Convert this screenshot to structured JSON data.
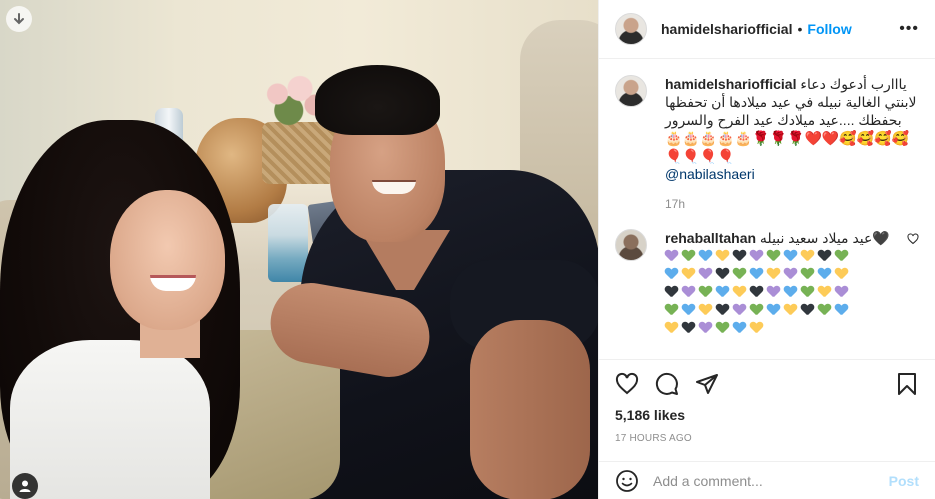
{
  "post": {
    "username": "hamidelshariofficial",
    "follow_label": "Follow",
    "dot": "•",
    "more_label": "•••"
  },
  "caption": {
    "username": "hamidelshariofficial",
    "text": "يااارب أدعوك دعاء لابنتي الغالية نبيله في عيد ميلادها أن تحفظها بحفظك ....عيد ميلادك عيد الفرح والسرور🥰🥰🥰🥰❤️❤️🌹🌹🌹🎂🎂🎂🎂🎂🎈🎈🎈🎈",
    "mention": "@nabilashaeri",
    "time": "17h"
  },
  "reply": {
    "username": "rehaballtahan",
    "text": "🖤عيد ميلاد سعيد نبيله",
    "heart_rows": [
      [
        "purple",
        "green",
        "blue",
        "yellow",
        "black",
        "purple",
        "green",
        "blue",
        "yellow",
        "black",
        "green"
      ],
      [
        "blue",
        "yellow",
        "purple",
        "black",
        "green",
        "blue",
        "yellow",
        "purple",
        "green",
        "blue",
        "yellow"
      ],
      [
        "black",
        "purple",
        "green",
        "blue",
        "yellow",
        "black",
        "purple",
        "blue",
        "green",
        "yellow",
        "purple"
      ],
      [
        "green",
        "blue",
        "yellow",
        "black",
        "purple",
        "green",
        "blue",
        "yellow",
        "black",
        "green",
        "blue"
      ],
      [
        "yellow",
        "black",
        "purple",
        "green",
        "blue",
        "yellow"
      ]
    ],
    "heart_colors": {
      "purple": "#aa8ed6",
      "green": "#77b255",
      "blue": "#5dadec",
      "yellow": "#fdcb58",
      "black": "#31373d"
    }
  },
  "stats": {
    "likes": "5,186 likes",
    "posted": "17 HOURS AGO"
  },
  "composer": {
    "placeholder": "Add a comment...",
    "post_label": "Post"
  }
}
